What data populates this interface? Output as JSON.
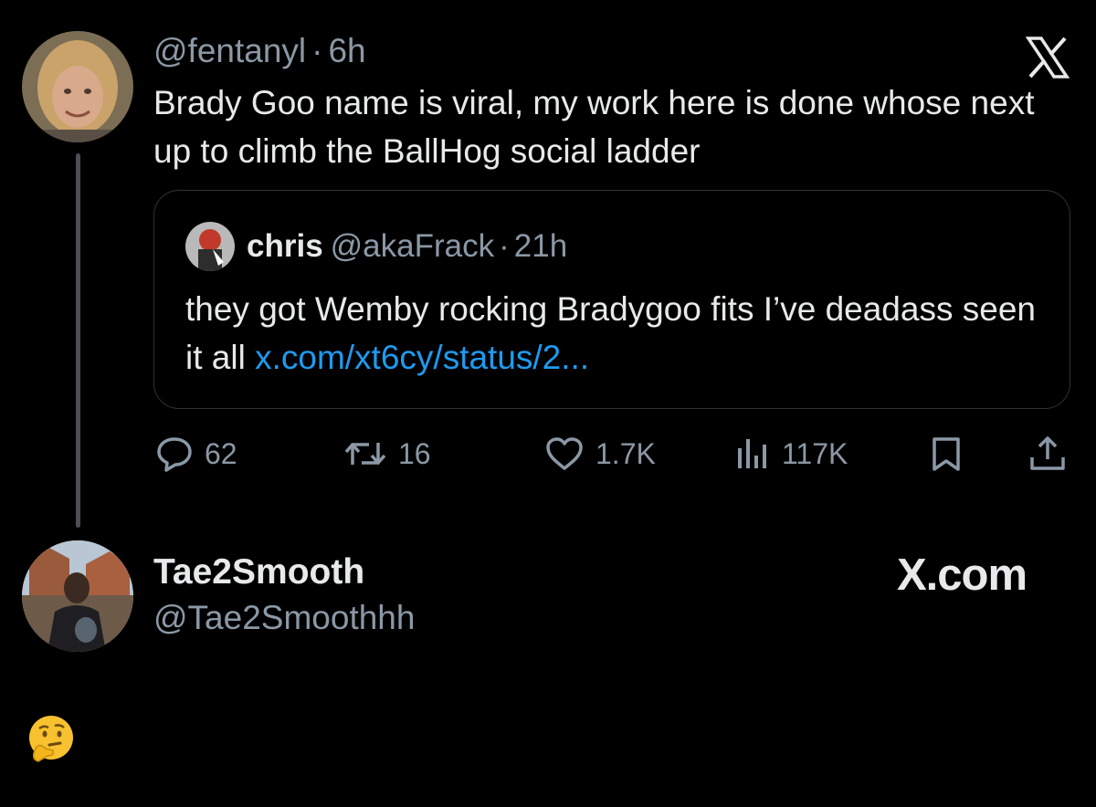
{
  "tweet": {
    "handle": "@fentanyl",
    "separator": "·",
    "time": "6h",
    "text": "Brady Goo name is viral, my work here is done whose next up to climb the BallHog social ladder",
    "logo_icon": "x-logo-icon"
  },
  "quote": {
    "name": "chris",
    "handle": "@akaFrack",
    "separator": "·",
    "time": "21h",
    "text": "they got Wemby rocking Bradygoo fits I’ve deadass seen it all",
    "link": "x.com/xt6cy/status/2..."
  },
  "actions": {
    "replies": "62",
    "retweets": "16",
    "likes": "1.7K",
    "views": "117K",
    "icons": [
      "reply-icon",
      "retweet-icon",
      "like-icon",
      "views-icon",
      "bookmark-icon",
      "share-icon"
    ]
  },
  "author": {
    "name": "Tae2Smooth",
    "handle": "@Tae2Smoothhh",
    "site": "X.com"
  },
  "colors": {
    "background": "#000000",
    "text": "#e7e9ea",
    "muted": "#8b98a5",
    "link": "#1d9bf0",
    "border": "#2f3336"
  }
}
